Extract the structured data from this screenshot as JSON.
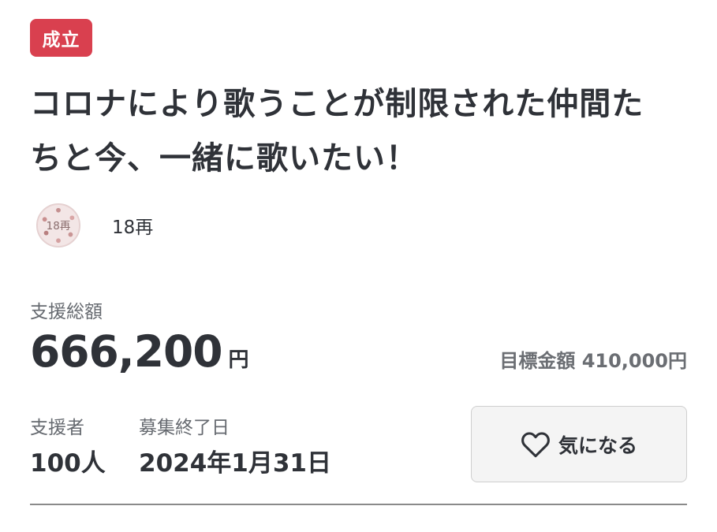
{
  "status_badge": "成立",
  "project": {
    "title": "コロナにより歌うことが制限された仲間たちと今、一緒に歌いたい！"
  },
  "owner": {
    "name": "18再",
    "avatar_text": "18再"
  },
  "funding": {
    "total_label": "支援総額",
    "total_value": "666,200",
    "total_unit": "円",
    "goal_label": "目標金額",
    "goal_value": "410,000円"
  },
  "supporters": {
    "label": "支援者",
    "value": "100人"
  },
  "end_date": {
    "label": "募集終了日",
    "value": "2024年1月31日"
  },
  "favorite_button": {
    "icon": "heart-icon",
    "label": "気になる"
  }
}
